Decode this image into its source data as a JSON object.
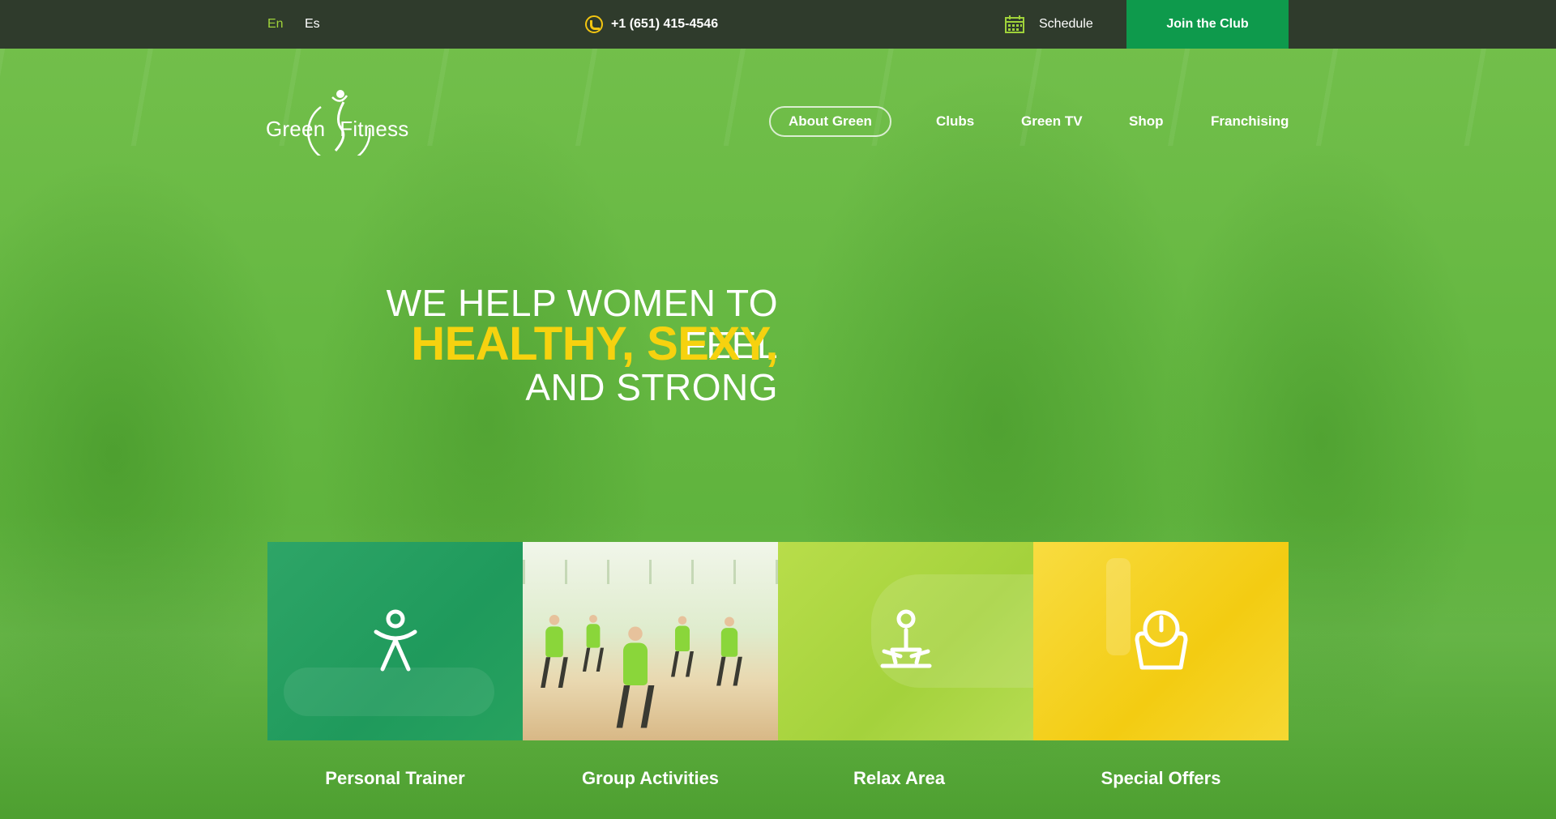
{
  "colors": {
    "topbar_bg": "#2f3b2c",
    "accent_green": "#0e9a4c",
    "accent_yellow": "#f6d20f",
    "active_lang": "#9fd23a"
  },
  "topbar": {
    "languages": [
      {
        "label": "En",
        "active": true
      },
      {
        "label": "Es",
        "active": false
      }
    ],
    "phone": "+1 (651) 415-4546",
    "schedule_label": "Schedule",
    "join_label": "Join the Club"
  },
  "header": {
    "logo_word1": "Green",
    "logo_word2": "Fitness",
    "nav": [
      {
        "label": "About Green",
        "active": true
      },
      {
        "label": "Clubs",
        "active": false
      },
      {
        "label": "Green TV",
        "active": false
      },
      {
        "label": "Shop",
        "active": false
      },
      {
        "label": "Franchising",
        "active": false
      }
    ]
  },
  "hero": {
    "line1": "WE HELP WOMEN TO FEEL",
    "line2": "HEALTHY, SEXY,",
    "line3": "AND STRONG"
  },
  "features": [
    {
      "label": "Personal Trainer",
      "icon": "person-jumping-icon"
    },
    {
      "label": "Group Activities",
      "icon": "group-photo"
    },
    {
      "label": "Relax Area",
      "icon": "meditation-icon"
    },
    {
      "label": "Special Offers",
      "icon": "scale-icon"
    }
  ]
}
